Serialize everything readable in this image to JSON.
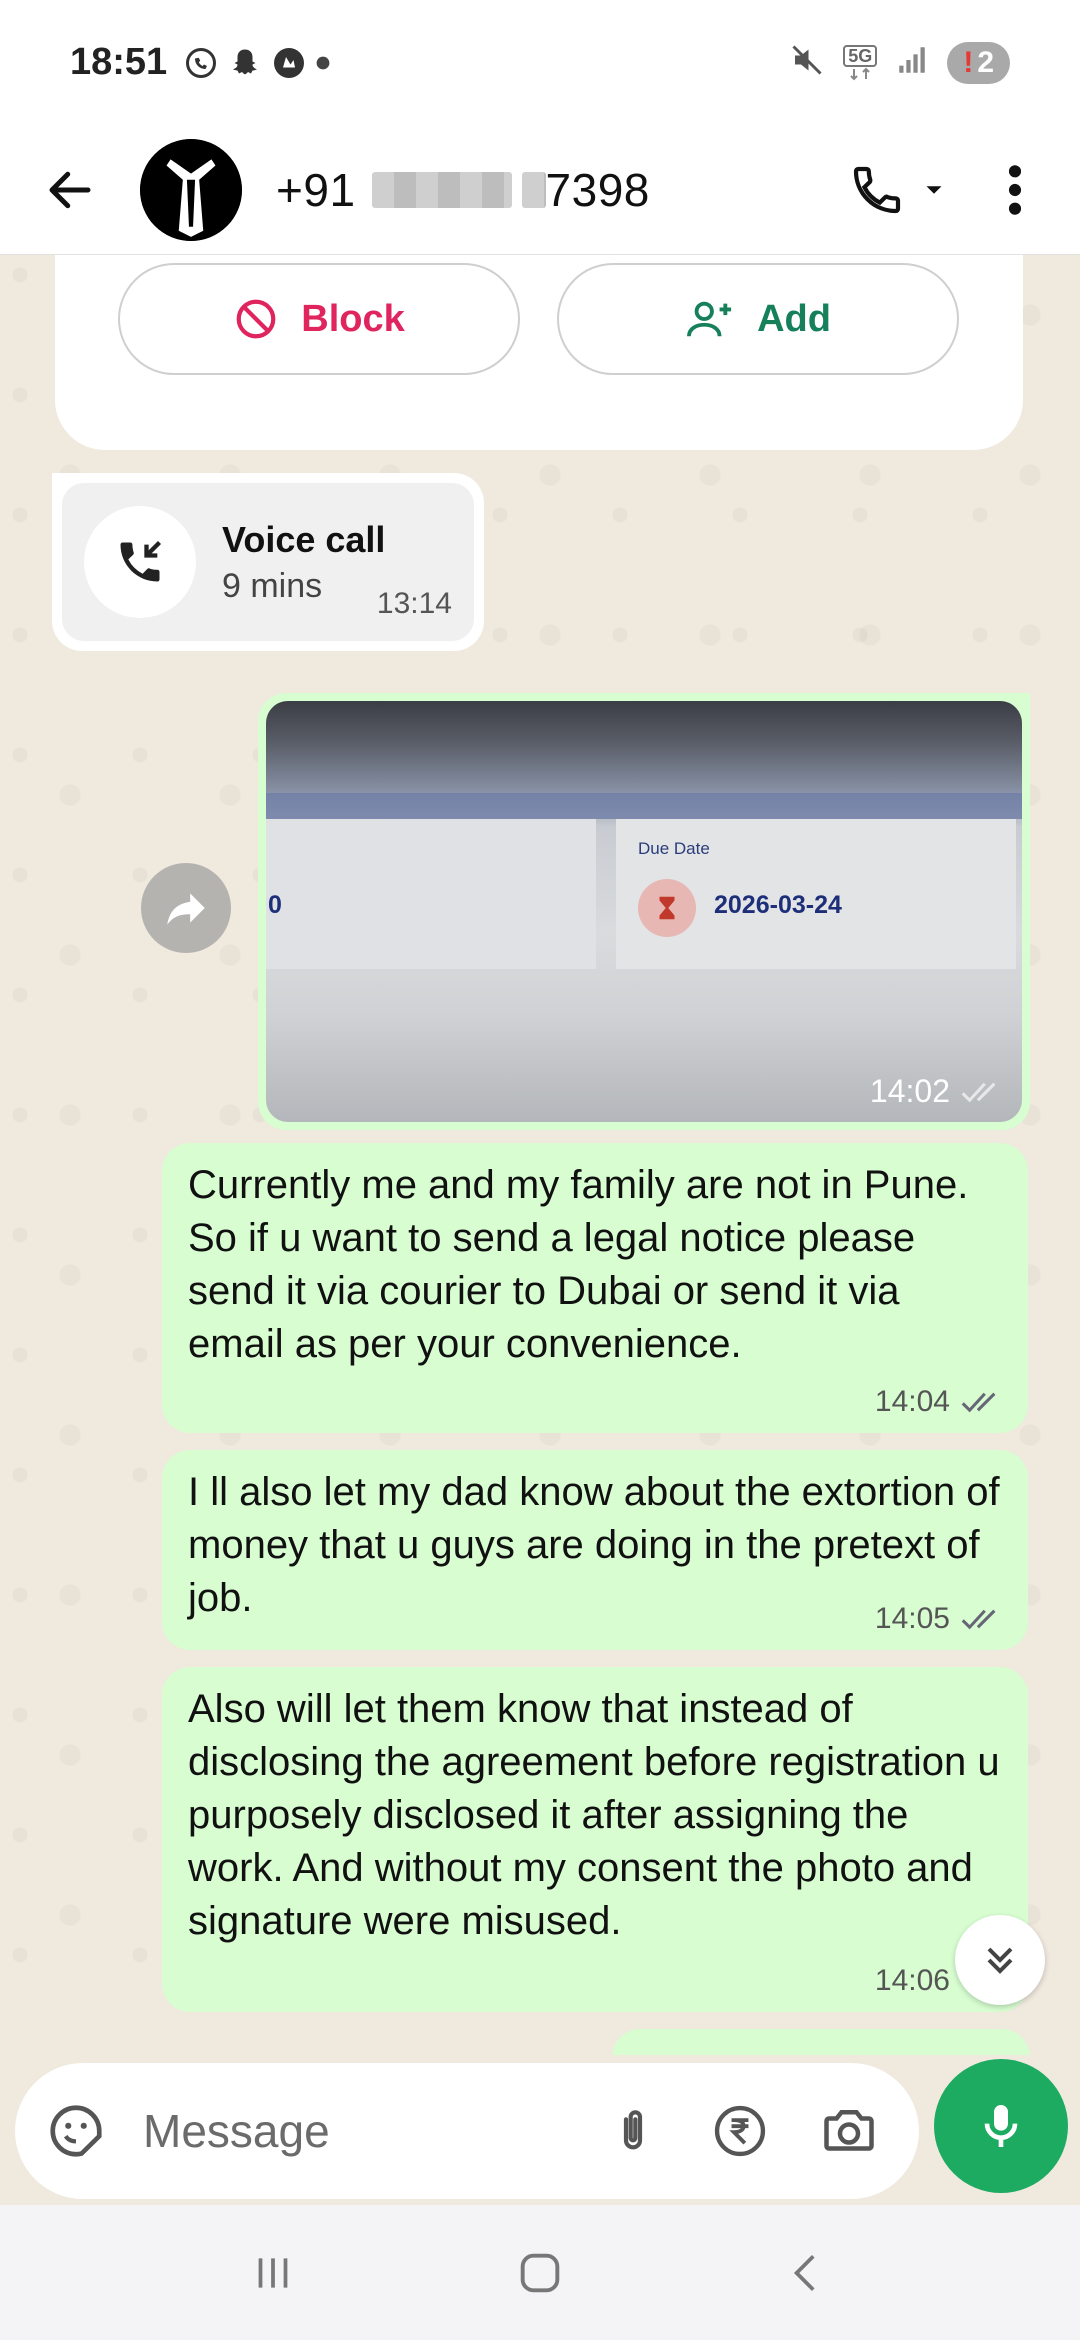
{
  "status_bar": {
    "time": "18:51",
    "network": "5G",
    "battery_level": "2"
  },
  "header": {
    "phone_prefix": "+91",
    "phone_suffix": "7398"
  },
  "actions": {
    "block_label": "Block",
    "add_label": "Add"
  },
  "messages": {
    "voice_call": {
      "title": "Voice call",
      "duration": "9 mins",
      "time": "13:14"
    },
    "image": {
      "due_label": "Due Date",
      "due_date": "2026-03-24",
      "left_partial": "0",
      "time": "14:02"
    },
    "texts": [
      {
        "text": "Currently me and my family are not in Pune. So if u want to send a legal notice please send it via courier to Dubai or send it via email as per your convenience.",
        "time": "14:04"
      },
      {
        "text": "I ll also let my dad know about the extortion of money that u guys are doing in the pretext of job.",
        "time": "14:05"
      },
      {
        "text": "Also will let them know that instead of disclosing the agreement before registration u purposely disclosed it after assigning the work. And without my consent the photo and signature were misused.",
        "time": "14:06"
      }
    ]
  },
  "input": {
    "placeholder": "Message"
  },
  "colors": {
    "outgoing_bubble": "#d7fdd1",
    "accent_green": "#1daa61",
    "block_red": "#e0245e",
    "add_green": "#15805a"
  }
}
